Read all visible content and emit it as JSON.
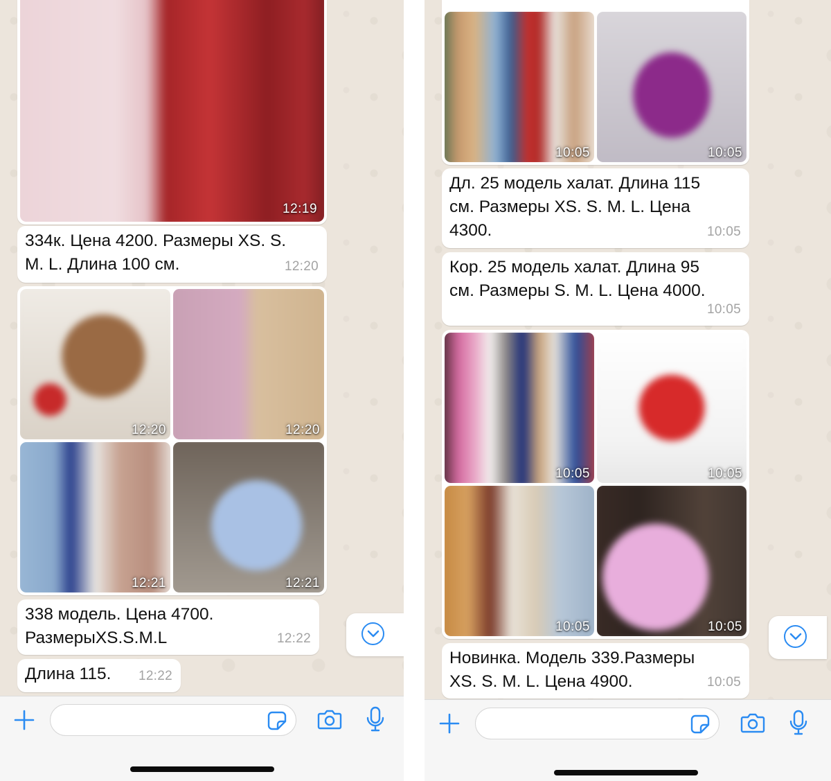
{
  "left": {
    "image_timestamps": [
      "12:19",
      "12:20",
      "12:20",
      "12:21",
      "12:21"
    ],
    "messages": [
      {
        "text": "334к. Цена 4200. Размеры XS. S.\nM. L. Длина 100 см.",
        "time": "12:20"
      },
      {
        "text": "338 модель. Цена 4700.\nРазмерыXS.S.M.L",
        "time": "12:22"
      },
      {
        "text": "Длина 115.",
        "time": "12:22"
      }
    ]
  },
  "right": {
    "image_timestamps": [
      "10:05",
      "10:05",
      "10:05",
      "10:05",
      "10:05",
      "10:05"
    ],
    "messages": [
      {
        "text": "Дл. 25 модель халат. Длина 115\nсм. Размеры XS. S. M. L. Цена\n4300.",
        "time": "10:05"
      },
      {
        "text": "Кор. 25 модель халат. Длина 95\nсм. Размеры S. M. L. Цена 4000.",
        "time": "10:05"
      },
      {
        "text": "Новинка. Модель 339.Размеры\nXS. S. M. L. Цена 4900.",
        "time": "10:05"
      }
    ]
  },
  "input_bar": {
    "icons": [
      "plus-icon",
      "sticker-icon",
      "camera-icon",
      "microphone-icon"
    ],
    "accent_color": "#2a8bf2"
  },
  "colors": {
    "chat_background": "#ece5dc",
    "bubble": "#ffffff",
    "timestamp": "#a3a3a3"
  }
}
